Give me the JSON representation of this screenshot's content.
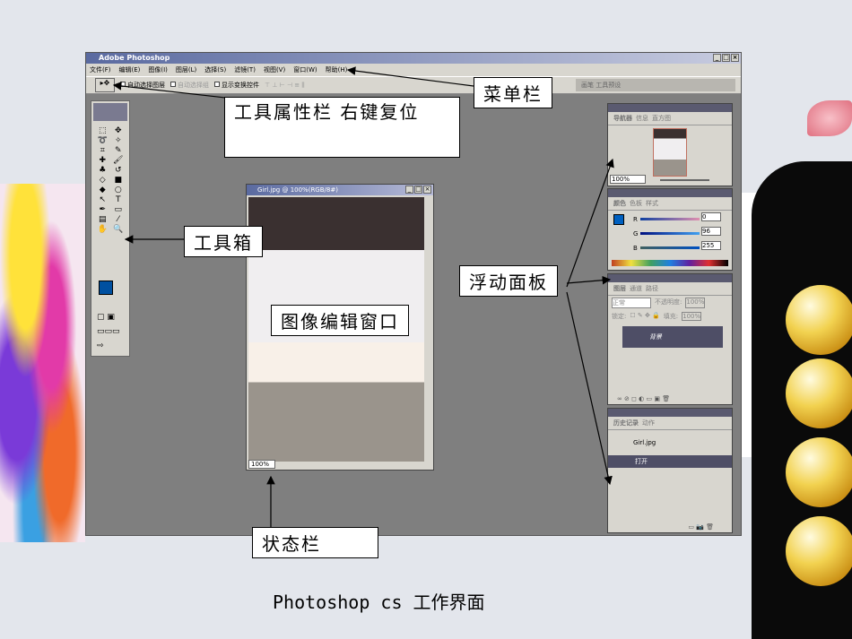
{
  "window": {
    "title": "Adobe Photoshop"
  },
  "menu": [
    "文件(F)",
    "编辑(E)",
    "图像(I)",
    "图层(L)",
    "选择(S)",
    "滤镜(T)",
    "视图(V)",
    "窗口(W)",
    "帮助(H)"
  ],
  "options": {
    "auto_select_layer": "自动选择图层",
    "auto_select_group": "自动选择组",
    "show_transform": "显示变换控件",
    "palette_well": "画笔  工具预设"
  },
  "image_window": {
    "title": "Girl.jpg @ 100%(RGB/8#)",
    "zoom": "100%"
  },
  "navigator": {
    "tabs": [
      "导航器",
      "信息",
      "直方图"
    ],
    "zoom": "100%"
  },
  "color": {
    "tabs": [
      "颜色",
      "色板",
      "样式"
    ],
    "r": "0",
    "g": "96",
    "b": "255",
    "fg": "#0060ff"
  },
  "layers": {
    "tabs": [
      "图层",
      "通道",
      "路径"
    ],
    "mode": "正常",
    "opacity_label": "不透明度:",
    "opacity": "100%",
    "lock_label": "锁定:",
    "fill_label": "填充:",
    "fill": "100%",
    "layer": "背景"
  },
  "history": {
    "tabs": [
      "历史记录",
      "动作"
    ],
    "snapshot": "Girl.jpg",
    "step": "打开"
  },
  "callouts": {
    "options_bar": "工具属性栏    右键复位",
    "menubar": "菜单栏",
    "toolbox": "工具箱",
    "panels": "浮动面板",
    "image_window": "图像编辑窗口",
    "status_bar": "状态栏"
  },
  "caption": "Photoshop cs  工作界面"
}
